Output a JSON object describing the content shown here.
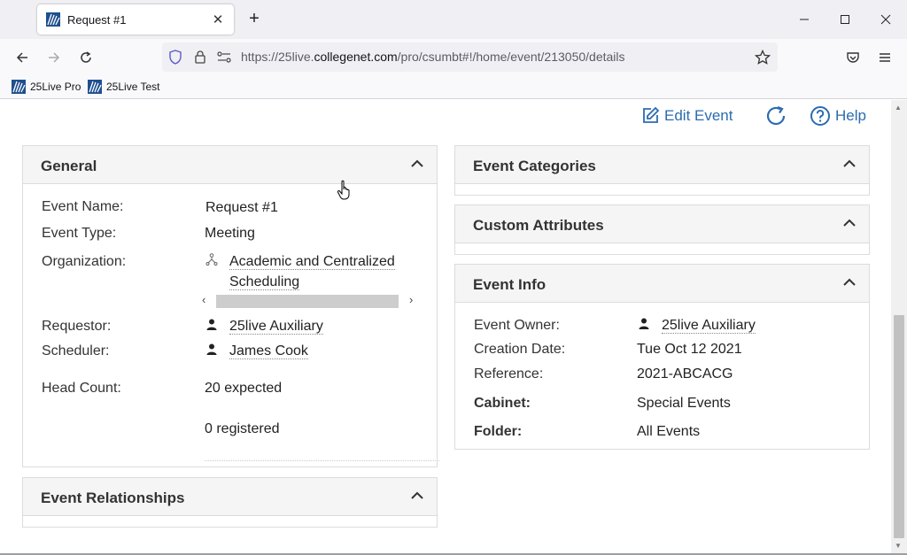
{
  "browser": {
    "tab_title": "Request #1",
    "url_prefix": "https://25live.",
    "url_domain": "collegenet.com",
    "url_path": "/pro/csumbt#!/home/event/213050/details",
    "bookmarks": [
      "25Live Pro",
      "25Live Test"
    ]
  },
  "actions": {
    "edit_label": "Edit Event",
    "help_label": "Help"
  },
  "general": {
    "title": "General",
    "event_name_label": "Event Name:",
    "event_name": "Request #1",
    "event_type_label": "Event Type:",
    "event_type": "Meeting",
    "organization_label": "Organization:",
    "organization_line1": "Academic and Centralized",
    "organization_line2": "Scheduling",
    "requestor_label": "Requestor:",
    "requestor": "25live Auxiliary",
    "scheduler_label": "Scheduler:",
    "scheduler": "James Cook",
    "head_count_label": "Head Count:",
    "expected": "20 expected",
    "registered": "0 registered"
  },
  "relationships": {
    "title": "Event Relationships"
  },
  "categories": {
    "title": "Event Categories"
  },
  "custom_attributes": {
    "title": "Custom Attributes"
  },
  "event_info": {
    "title": "Event Info",
    "owner_label": "Event Owner:",
    "owner": "25live Auxiliary",
    "creation_label": "Creation Date:",
    "creation_date": "Tue Oct 12 2021",
    "reference_label": "Reference:",
    "reference": "2021-ABCACG",
    "cabinet_label": "Cabinet:",
    "cabinet": "Special Events",
    "folder_label": "Folder:",
    "folder": "All Events"
  },
  "colors": {
    "link_blue": "#2b6cb0",
    "panel_header": "#f5f5f5"
  }
}
